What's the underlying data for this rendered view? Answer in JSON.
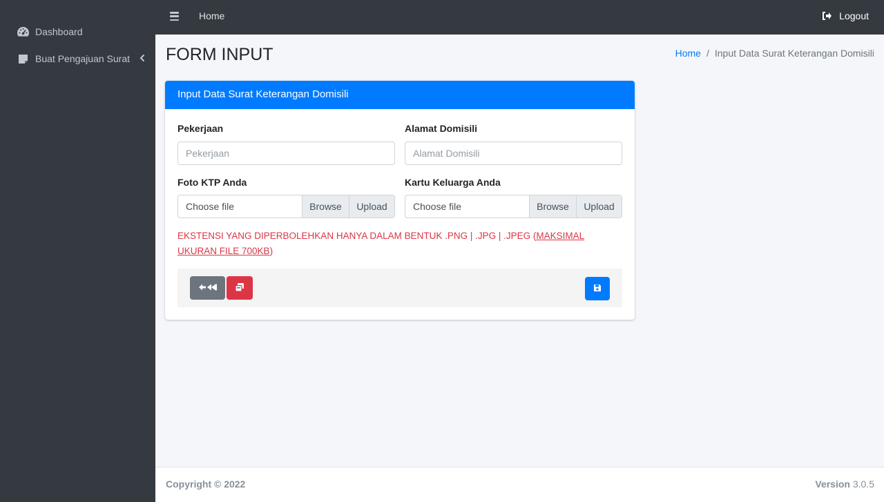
{
  "sidebar": {
    "items": [
      {
        "label": "Dashboard",
        "icon": "tachometer-icon"
      },
      {
        "label": "Buat Pengajuan Surat",
        "icon": "sticky-note-icon"
      }
    ]
  },
  "topbar": {
    "home_label": "Home",
    "logout_label": "Logout"
  },
  "page": {
    "title": "FORM INPUT",
    "breadcrumb": [
      "Home",
      "Input Data Surat Keterangan Domisili"
    ]
  },
  "card": {
    "header": "Input Data Surat Keterangan Domisili",
    "fields": {
      "pekerjaan": {
        "label": "Pekerjaan",
        "placeholder": "Pekerjaan",
        "value": ""
      },
      "alamat": {
        "label": "Alamat Domisili",
        "placeholder": "Alamat Domisili",
        "value": ""
      },
      "ktp": {
        "label": "Foto KTP Anda",
        "choose": "Choose file",
        "browse": "Browse",
        "upload": "Upload"
      },
      "kk": {
        "label": "Kartu Keluarga Anda",
        "choose": "Choose file",
        "browse": "Browse",
        "upload": "Upload"
      }
    },
    "warning_main": "EKSTENSI YANG DIPERBOLEHKAN HANYA DALAM BENTUK .PNG | .JPG | .JPEG (",
    "warning_underlined": "MAKSIMAL UKURAN FILE 700KB",
    "warning_close": ")"
  },
  "footer": {
    "copyright": "Copyright © 2022",
    "version_label": "Version",
    "version_value": "3.0.5"
  },
  "colors": {
    "primary": "#007bff",
    "danger": "#dc3545",
    "secondary": "#6c757d",
    "sidebar": "#343a40"
  }
}
